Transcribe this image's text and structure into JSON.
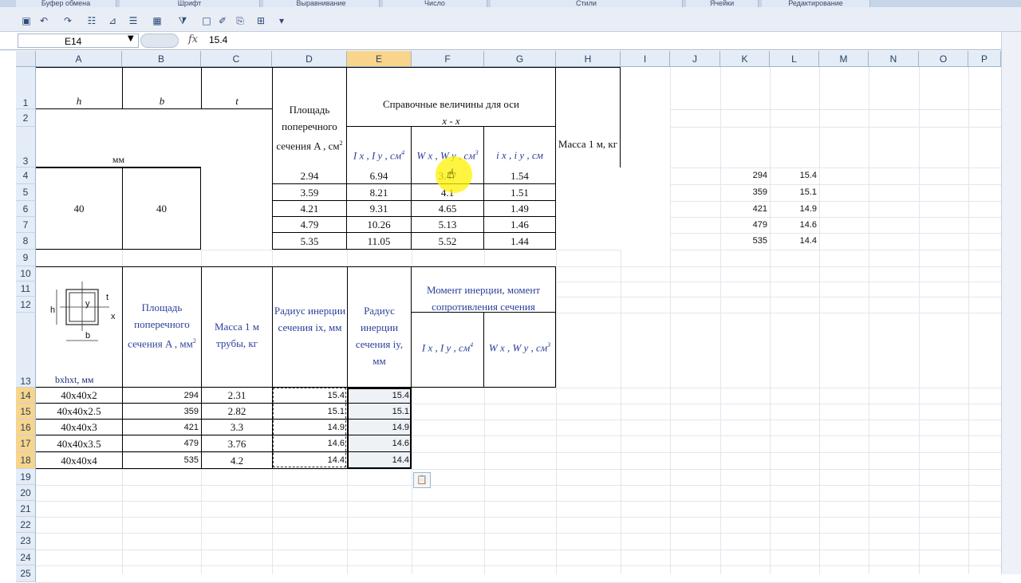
{
  "ribbon_groups": [
    "Буфер обмена",
    "Шрифт",
    "Выравнивание",
    "Число",
    "Стили",
    "Ячейки",
    "Редактирование"
  ],
  "formula_bar": {
    "name_box": "E14",
    "fx": "fx",
    "value": "15.4"
  },
  "columns": [
    "A",
    "B",
    "C",
    "D",
    "E",
    "F",
    "G",
    "H",
    "I",
    "J",
    "K",
    "L",
    "M",
    "N",
    "O",
    "P"
  ],
  "rows": [
    "1",
    "2",
    "3",
    "4",
    "5",
    "6",
    "7",
    "8",
    "9",
    "10",
    "11",
    "12",
    "13",
    "14",
    "15",
    "16",
    "17",
    "18",
    "19",
    "20",
    "21",
    "22",
    "23",
    "24",
    "25"
  ],
  "top_table": {
    "h": "h",
    "b": "b",
    "t": "t",
    "unit_mm": "мм",
    "area": "Площадь поперечного сечения A , см",
    "area_sup": "2",
    "axis_header": "Справочные величины для оси",
    "axis": "x - x",
    "col_I": "I x , I y , см",
    "col_I_sup": "4",
    "col_W": "W x , W y , см",
    "col_W_sup": "3",
    "col_i": "i x , i y , см",
    "mass": "Масса 1 м, кг",
    "h_val": "40",
    "b_val": "40",
    "rows": [
      {
        "A": "2.94",
        "I": "6.94",
        "W": "3.47",
        "i": "1.54"
      },
      {
        "A": "3.59",
        "I": "8.21",
        "W": "4.1",
        "i": "1.51"
      },
      {
        "A": "4.21",
        "I": "9.31",
        "W": "4.65",
        "i": "1.49"
      },
      {
        "A": "4.79",
        "I": "10.26",
        "W": "5.13",
        "i": "1.46"
      },
      {
        "A": "5.35",
        "I": "11.05",
        "W": "5.52",
        "i": "1.44"
      }
    ]
  },
  "side_values": [
    {
      "k": "294",
      "l": "15.4"
    },
    {
      "k": "359",
      "l": "15.1"
    },
    {
      "k": "421",
      "l": "14.9"
    },
    {
      "k": "479",
      "l": "14.6"
    },
    {
      "k": "535",
      "l": "14.4"
    }
  ],
  "bottom_table": {
    "dims": "bxhxt, мм",
    "area": "Площадь поперечного сечения A , мм",
    "area_sup": "2",
    "mass": "Масса 1 м трубы, кг",
    "rad_x": "Радиус инерции сечения ix, мм",
    "rad_y": "Радиус инерции сечения iy, мм",
    "moment_header": "Момент инерции, момент сопротивления сечения",
    "col_I": "I x , I y , см",
    "col_I_sup": "4",
    "col_W": "W x , W y , см",
    "col_W_sup": "3",
    "sketch_labels": {
      "h": "h",
      "y": "y",
      "t": "t",
      "x": "x",
      "b": "b"
    },
    "rows": [
      {
        "dim": "40x40x2",
        "area": "294",
        "mass": "2.31",
        "rx": "15.4",
        "ry": "15.4"
      },
      {
        "dim": "40x40x2.5",
        "area": "359",
        "mass": "2.82",
        "rx": "15.1",
        "ry": "15.1"
      },
      {
        "dim": "40x40x3",
        "area": "421",
        "mass": "3.3",
        "rx": "14.9",
        "ry": "14.9"
      },
      {
        "dim": "40x40x3.5",
        "area": "479",
        "mass": "3.76",
        "rx": "14.6",
        "ry": "14.6"
      },
      {
        "dim": "40x40x4",
        "area": "535",
        "mass": "4.2",
        "rx": "14.4",
        "ry": "14.4"
      }
    ]
  },
  "colors": {
    "selection": "#f8d58a",
    "grid": "#e1e6ee",
    "header": "#e4ecf7",
    "highlight": "#fff200"
  }
}
